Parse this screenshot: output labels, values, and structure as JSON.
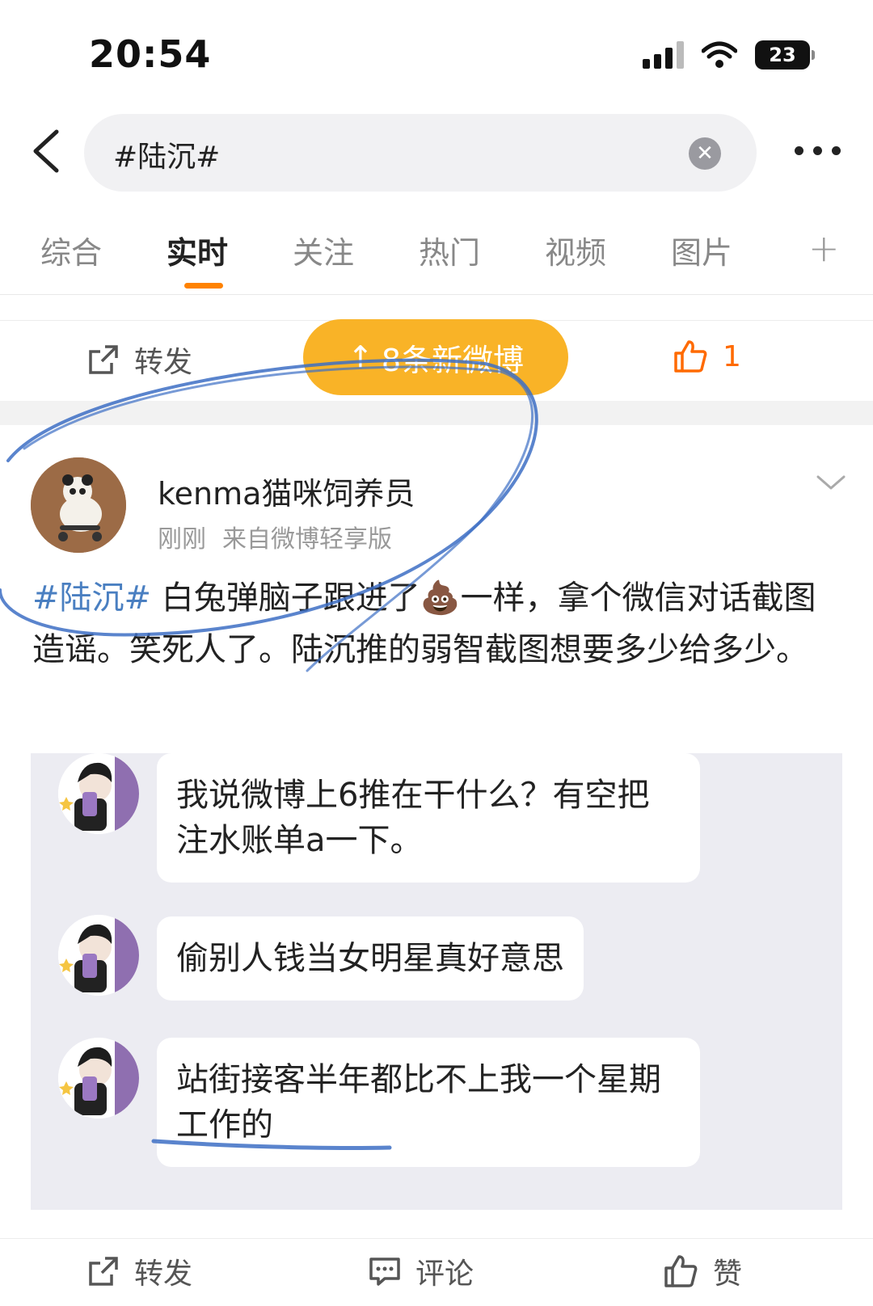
{
  "status_bar": {
    "time": "20:54",
    "battery": "23"
  },
  "search": {
    "query": "#陆沉#"
  },
  "tabs": [
    {
      "label": "综合"
    },
    {
      "label": "实时",
      "active": true
    },
    {
      "label": "关注"
    },
    {
      "label": "热门"
    },
    {
      "label": "视频"
    },
    {
      "label": "图片"
    }
  ],
  "prev_post_actions": {
    "repost_label": "转发",
    "like_count": "1"
  },
  "new_posts_banner": {
    "label": "8条新微博",
    "arrow": "↑"
  },
  "post": {
    "username": "kenma猫咪饲养员",
    "time": "刚刚",
    "source": "来自微博轻享版",
    "hashtag": "#陆沉#",
    "text_part1": " 白兔弹脑子跟进了",
    "emoji": "💩",
    "text_part2": "一样，拿个微信对话截图造谣。笑死人了。陆沉推的弱智截图想要多少给多少。"
  },
  "chat_messages": [
    {
      "text": "我说微博上6推在干什么？有空把注水账单a一下。"
    },
    {
      "text": "偷别人钱当女明星真好意思"
    },
    {
      "text": "站街接客半年都比不上我一个星期工作的"
    }
  ],
  "bottom_actions": {
    "repost_label": "转发",
    "comment_label": "评论",
    "like_label": "赞"
  },
  "colors": {
    "accent": "#ff8200",
    "hashtag": "#4a7fc1",
    "banner": "#f9b327",
    "scribble": "#3d6fc4"
  }
}
